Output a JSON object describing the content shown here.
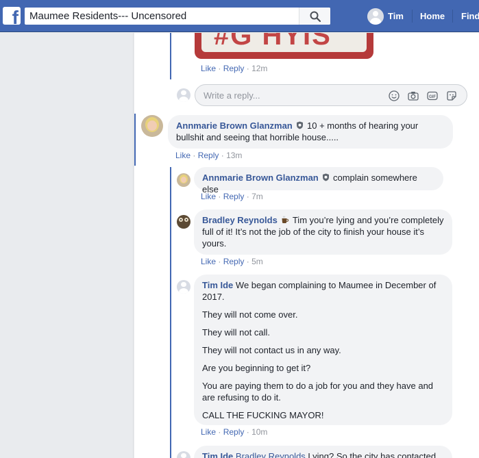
{
  "header": {
    "search_value": "Maumee Residents--- Uncensored",
    "profile_name": "Tim",
    "home_label": "Home",
    "find_friends_label": "Find"
  },
  "actions": {
    "like": "Like",
    "reply": "Reply",
    "sep": "·"
  },
  "reply_box": {
    "placeholder": "Write a reply..."
  },
  "comments": [
    {
      "time": "12m"
    },
    {
      "author": "Annmarie Brown Glanzman",
      "text": "10 + months of hearing your bullshit and seeing that horrible house.....",
      "time": "13m"
    },
    {
      "author": "Annmarie Brown Glanzman",
      "text": "complain somewhere else",
      "time": "7m"
    },
    {
      "author": "Bradley Reynolds",
      "text": "Tim you’re lying and you’re completely full of it! It’s not the job of the city to finish your house it’s yours.",
      "time": "5m"
    },
    {
      "author": "Tim Ide",
      "paragraphs": [
        "We began complaining to Maumee in December of 2017.",
        "They will not come over.",
        "They will not call.",
        "They will not contact us in any way.",
        "Are you beginning to get it?",
        "You are paying them to do a job for you and they have and are refusing to do it.",
        "CALL THE FUCKING MAYOR!"
      ],
      "time": "10m"
    },
    {
      "author": "Tim Ide",
      "mention": "Bradley Reynolds",
      "text": "Lying? So the city has contacted"
    }
  ],
  "photo_text": "#G HYIS"
}
